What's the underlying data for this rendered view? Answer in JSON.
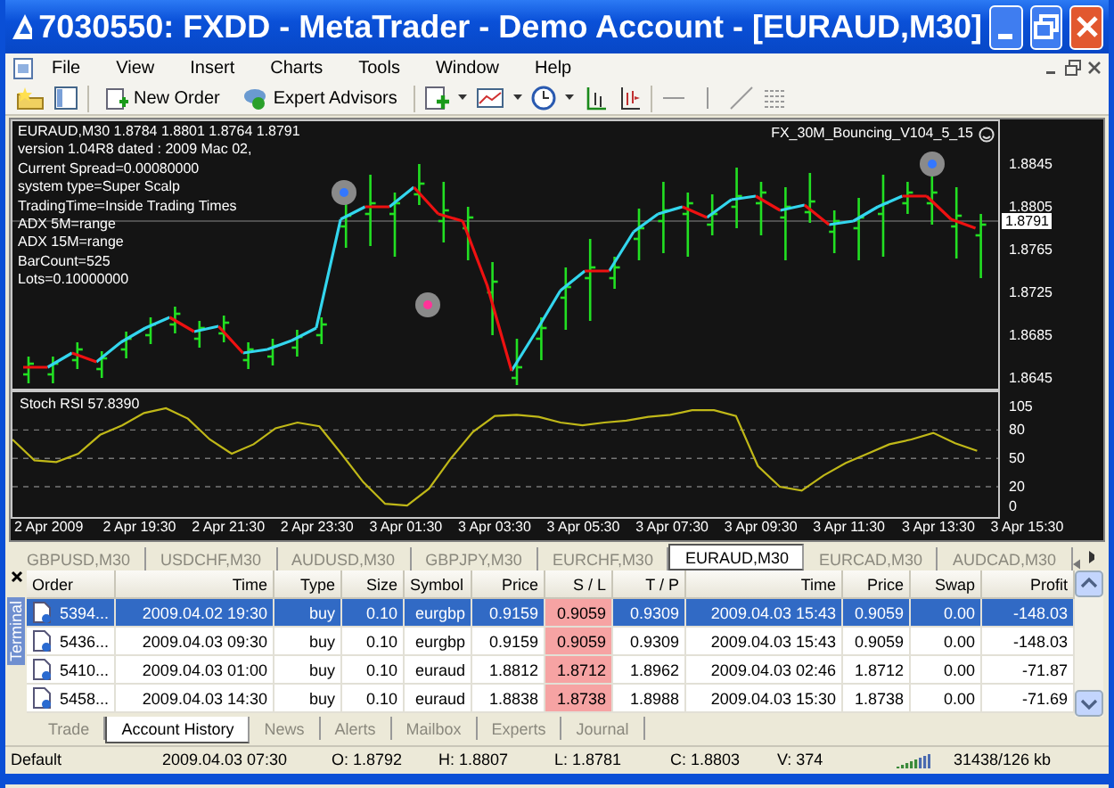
{
  "window": {
    "title": "7030550: FXDD - MetaTrader - Demo Account - [EURAUD,M30]"
  },
  "menu": [
    "File",
    "View",
    "Insert",
    "Charts",
    "Tools",
    "Window",
    "Help"
  ],
  "toolbar": {
    "buttons": [
      {
        "label": "New Order",
        "kind": "order"
      },
      {
        "label": "Expert Advisors",
        "kind": "expert"
      }
    ]
  },
  "chart": {
    "info_lines": [
      "EURAUD,M30  1.8784 1.8801 1.8764 1.8791",
      "version 1.04R8 dated : 2009 Mac 02,",
      "Current Spread=0.00080000",
      "system type=Super Scalp",
      "TradingTime=Inside Trading Times",
      "ADX 5M=range",
      "ADX 15M=range",
      "BarCount=525",
      "Lots=0.10000000"
    ],
    "expert_name": "FX_30M_Bouncing_V104_5_15",
    "price_labels": [
      "1.8845",
      "1.8805",
      "1.8765",
      "1.8725",
      "1.8685",
      "1.8645"
    ],
    "current_price": "1.8791",
    "indicator": {
      "label": "Stoch RSI 57.8390",
      "chart_data": {
        "type": "line",
        "ylim": [
          -12,
          120
        ],
        "grid": true,
        "yticks": [
          0,
          20,
          50,
          80,
          105
        ],
        "series": [
          {
            "color": "#c0b818",
            "values": [
              70,
              48,
              46,
              55,
              75,
              85,
              98,
              103,
              92,
              70,
              55,
              65,
              82,
              88,
              84,
              55,
              25,
              2,
              0,
              18,
              50,
              78,
              95,
              96,
              94,
              88,
              85,
              88,
              90,
              94,
              96,
              101,
              101,
              95,
              42,
              20,
              16,
              32,
              45,
              55,
              65,
              70,
              77,
              66,
              58
            ]
          }
        ]
      }
    },
    "time_labels": [
      "2 Apr 2009",
      "2 Apr 19:30",
      "2 Apr 21:30",
      "2 Apr 23:30",
      "3 Apr 01:30",
      "3 Apr 03:30",
      "3 Apr 05:30",
      "3 Apr 07:30",
      "3 Apr 09:30",
      "3 Apr 11:30",
      "3 Apr 13:30",
      "3 Apr 15:30"
    ]
  },
  "chart_tabs": [
    {
      "label": "GBPUSD,M30",
      "selected": false
    },
    {
      "label": "USDCHF,M30",
      "selected": false
    },
    {
      "label": "AUDUSD,M30",
      "selected": false
    },
    {
      "label": "GBPJPY,M30",
      "selected": false
    },
    {
      "label": "EURCHF,M30",
      "selected": false
    },
    {
      "label": "EURAUD,M30",
      "selected": true
    },
    {
      "label": "EURCAD,M30",
      "selected": false
    },
    {
      "label": "AUDCAD,M30",
      "selected": false
    }
  ],
  "terminal": {
    "title": "Terminal",
    "columns": [
      "Order",
      "Time",
      "Type",
      "Size",
      "Symbol",
      "Price",
      "S / L",
      "T / P",
      "Time",
      "Price",
      "Swap",
      "Profit"
    ],
    "rows": [
      {
        "selected": true,
        "cells": [
          "5394...",
          "2009.04.02 19:30",
          "buy",
          "0.10",
          "eurgbp",
          "0.9159",
          "0.9059",
          "0.9309",
          "2009.04.03 15:43",
          "0.9059",
          "0.00",
          "-148.03"
        ]
      },
      {
        "selected": false,
        "cells": [
          "5436...",
          "2009.04.03 09:30",
          "buy",
          "0.10",
          "eurgbp",
          "0.9159",
          "0.9059",
          "0.9309",
          "2009.04.03 15:43",
          "0.9059",
          "0.00",
          "-148.03"
        ]
      },
      {
        "selected": false,
        "cells": [
          "5410...",
          "2009.04.03 01:00",
          "buy",
          "0.10",
          "euraud",
          "1.8812",
          "1.8712",
          "1.8962",
          "2009.04.03 02:46",
          "1.8712",
          "0.00",
          "-71.87"
        ]
      },
      {
        "selected": false,
        "cells": [
          "5458...",
          "2009.04.03 14:30",
          "buy",
          "0.10",
          "euraud",
          "1.8838",
          "1.8738",
          "1.8988",
          "2009.04.03 15:30",
          "1.8738",
          "0.00",
          "-71.69"
        ]
      }
    ],
    "tabs": [
      {
        "label": "Trade",
        "selected": false
      },
      {
        "label": "Account History",
        "selected": true
      },
      {
        "label": "News",
        "selected": false
      },
      {
        "label": "Alerts",
        "selected": false
      },
      {
        "label": "Mailbox",
        "selected": false
      },
      {
        "label": "Experts",
        "selected": false
      },
      {
        "label": "Journal",
        "selected": false
      }
    ]
  },
  "status_bar": [
    "Default",
    "2009.04.03 07:30",
    "O: 1.8792",
    "H: 1.8807",
    "L: 1.8781",
    "C: 1.8803",
    "V: 374",
    "31438/126 kb"
  ]
}
